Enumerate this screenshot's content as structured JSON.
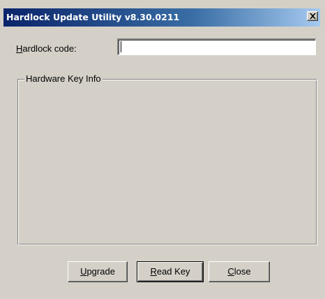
{
  "window": {
    "title": "Hardlock Update Utility v8.30.0211"
  },
  "form": {
    "code_label_accel": "H",
    "code_label_rest": "ardlock code:",
    "code_value": "",
    "group_label": "Hardware Key Info"
  },
  "buttons": {
    "upgrade_accel": "U",
    "upgrade_rest": "pgrade",
    "readkey_accel": "R",
    "readkey_rest": "ead Key",
    "close_accel": "C",
    "close_rest": "lose"
  },
  "colors": {
    "face": "#d4d0c8",
    "titlebar_start": "#0a246a",
    "titlebar_end": "#a6caf0"
  },
  "icons": {
    "close": "close-icon"
  }
}
